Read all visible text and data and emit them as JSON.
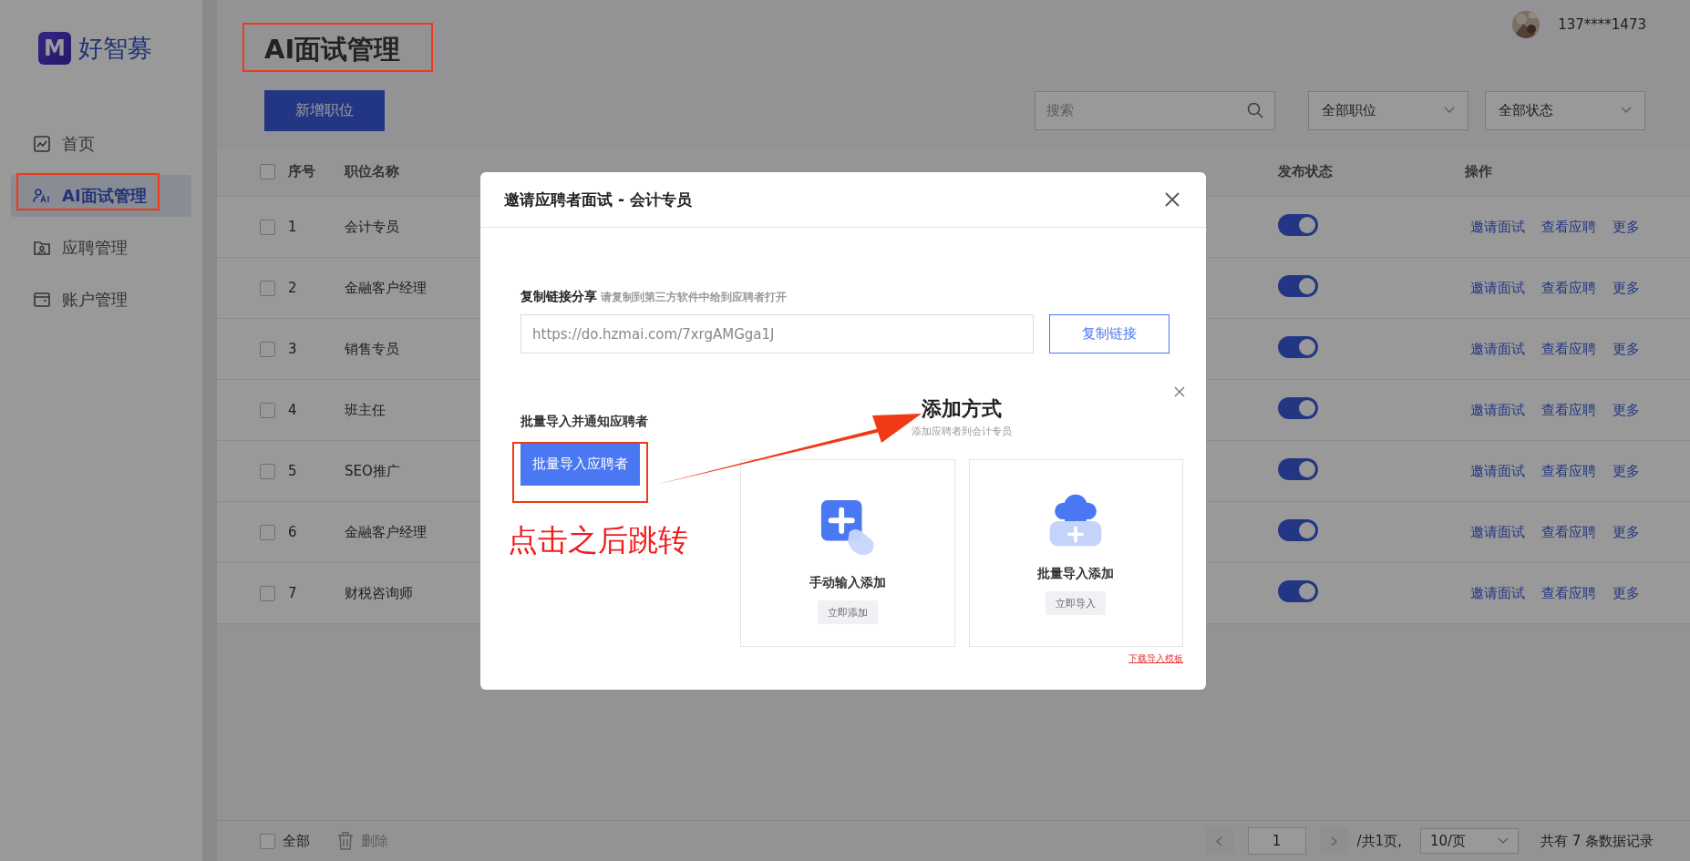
{
  "brand": {
    "logo_text": "M",
    "name": "好智募"
  },
  "user": {
    "name": "137****1473"
  },
  "sidebar": {
    "items": [
      {
        "kind": "home",
        "label": "首页",
        "selected": false
      },
      {
        "kind": "ai",
        "label": "AI面试管理",
        "selected": true
      },
      {
        "kind": "folder",
        "label": "应聘管理",
        "selected": false
      },
      {
        "kind": "wallet",
        "label": "账户管理",
        "selected": false
      }
    ]
  },
  "page_title": "AI面试管理",
  "toolbar": {
    "add_button": "新增职位",
    "search": {
      "placeholder": "搜索"
    },
    "filters": [
      "全部职位",
      "全部状态"
    ]
  },
  "table": {
    "header_checked": false,
    "columns": [
      {
        "label": "序号"
      },
      {
        "label": "职位名称"
      },
      {
        "label": "发布状态"
      },
      {
        "label": "操作"
      }
    ],
    "rows": [
      {
        "index": "1",
        "title": "会计专员",
        "checked": false,
        "published": true,
        "actions": [
          "邀请面试",
          "查看应聘",
          "更多"
        ]
      },
      {
        "index": "2",
        "title": "金融客户经理",
        "checked": false,
        "published": true,
        "actions": [
          "邀请面试",
          "查看应聘",
          "更多"
        ]
      },
      {
        "index": "3",
        "title": "销售专员",
        "checked": false,
        "published": true,
        "actions": [
          "邀请面试",
          "查看应聘",
          "更多"
        ]
      },
      {
        "index": "4",
        "title": "班主任",
        "checked": false,
        "published": true,
        "actions": [
          "邀请面试",
          "查看应聘",
          "更多"
        ]
      },
      {
        "index": "5",
        "title": "SEO推广",
        "checked": false,
        "published": true,
        "actions": [
          "邀请面试",
          "查看应聘",
          "更多"
        ]
      },
      {
        "index": "6",
        "title": "金融客户经理",
        "checked": false,
        "published": true,
        "actions": [
          "邀请面试",
          "查看应聘",
          "更多"
        ]
      },
      {
        "index": "7",
        "title": "财税咨询师",
        "checked": false,
        "published": true,
        "actions": [
          "邀请面试",
          "查看应聘",
          "更多"
        ]
      }
    ]
  },
  "footer": {
    "select_all": {
      "label": "全部",
      "checked": false
    },
    "delete": "删除",
    "page": "1",
    "total_pages": "/共1页,",
    "page_size": "10/页",
    "summary": "共有 7 条数据记录"
  },
  "modal": {
    "title": "邀请应聘者面试 - 会计专员",
    "share": {
      "label": "复制链接分享",
      "hint": "请复制到第三方软件中给到应聘者打开",
      "url": "https://do.hzmai.com/7xrgAMGga1J",
      "copy_button": "复制链接"
    },
    "bulk": {
      "label": "批量导入并通知应聘者",
      "button": "批量导入应聘者"
    },
    "add_panel": {
      "title": "添加方式",
      "subtitle": "添加应聘者到会计专员",
      "options": [
        {
          "kind": "manual",
          "label": "手动输入添加",
          "button": "立即添加"
        },
        {
          "kind": "bulk",
          "label": "批量导入添加",
          "button": "立即导入"
        }
      ],
      "template_link": "下载导入模板"
    }
  },
  "annotation": {
    "note": "点击之后跳转"
  }
}
